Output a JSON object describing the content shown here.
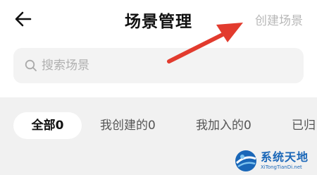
{
  "header": {
    "back_icon": "arrow-left-icon",
    "title": "场景管理",
    "create_label": "创建场景"
  },
  "search": {
    "placeholder": "搜索场景",
    "value": "",
    "icon": "search-icon"
  },
  "tabs": [
    {
      "label": "全部0",
      "active": true
    },
    {
      "label": "我创建的0",
      "active": false
    },
    {
      "label": "我加入的0",
      "active": false
    },
    {
      "label": "已归",
      "active": false
    }
  ],
  "annotation": {
    "arrow_color": "#e23b2e"
  },
  "watermark": {
    "title": "系统天地",
    "url": "XiTongTianDi.net",
    "brand_color": "#1a67b8"
  }
}
